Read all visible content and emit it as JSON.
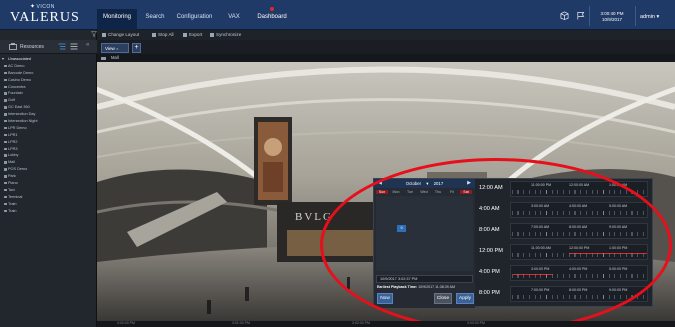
{
  "app": {
    "brand_small": "VICON",
    "brand": "VALERUS"
  },
  "nav": {
    "tabs": [
      {
        "label": "Monitoring"
      },
      {
        "label": "Search"
      },
      {
        "label": "Configuration"
      },
      {
        "label": "VAX"
      },
      {
        "label": "Dashboard"
      }
    ]
  },
  "header": {
    "time": "3:00:40 PM",
    "date": "10/9/2017",
    "user": "admin ▾"
  },
  "toolbar": {
    "change_layout": "Change Layout",
    "stop_all": "Stop All",
    "export": "Export",
    "synchronize": "Synchronize"
  },
  "sidebar": {
    "title": "Resources",
    "group": "Unassociated",
    "items": [
      "AC Demo",
      "Barcode Demo",
      "Casino Demo",
      "Concentra",
      "Fountain",
      "Golf",
      "GC East 360",
      "Intersection Day",
      "Intersection Night",
      "LPR Demo",
      "LPR1",
      "LPR2",
      "LPR3",
      "Lobby",
      "Mall",
      "POS Demo",
      "Park",
      "Piano",
      "Taxi",
      "Terminal",
      "Train",
      "Train"
    ]
  },
  "view": {
    "tab_label": "View",
    "add_label": "+",
    "camera_title": "Mall"
  },
  "calendar": {
    "month": "October",
    "year": "2017",
    "days": [
      "Sun",
      "Mon",
      "Tue",
      "Wed",
      "Thu",
      "Fri",
      "Sat"
    ],
    "selected_day": "9",
    "date_value": "10/9/2017 3:02:37 PM",
    "earliest_label": "Earliest Playback Time:",
    "earliest_value": "10/9/2017 11:38:39 AM",
    "now_label": "Now",
    "close_label": "Close",
    "apply_label": "Apply"
  },
  "time_rows": [
    {
      "label": "12:00 AM",
      "ticks": [
        "11:00:00 PM",
        "12:00:00 AM",
        "1:00:00 AM"
      ],
      "recorded": 0
    },
    {
      "label": "4:00 AM",
      "ticks": [
        "3:00:00 AM",
        "4:00:00 AM",
        "5:00:00 AM"
      ],
      "recorded": 0
    },
    {
      "label": "8:00 AM",
      "ticks": [
        "7:00:00 AM",
        "8:00:00 AM",
        "9:00:00 AM"
      ],
      "recorded": 0
    },
    {
      "label": "12:00 PM",
      "ticks": [
        "11:00:00 AM",
        "12:00:00 PM",
        "1:00:00 PM"
      ],
      "recorded": 1
    },
    {
      "label": "4:00 PM",
      "ticks": [
        "3:00:00 PM",
        "4:00:00 PM",
        "5:00:00 PM"
      ],
      "recorded": 1
    },
    {
      "label": "8:00 PM",
      "ticks": [
        "7:00:00 PM",
        "8:00:00 PM",
        "9:00:00 PM"
      ],
      "recorded": 0
    }
  ],
  "timeline": {
    "labels": [
      "3:00:00 PM",
      "3:01:00 PM",
      "3:02:00 PM",
      "3:03:00 PM"
    ]
  },
  "colors": {
    "accent": "#1f3a66",
    "highlight": "#e60f1a"
  }
}
